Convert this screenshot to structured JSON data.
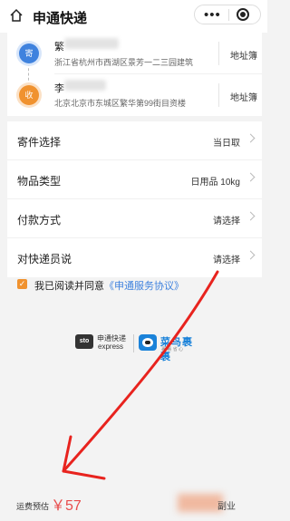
{
  "header": {
    "title": "申通快递"
  },
  "sender": {
    "badge": "寄",
    "name": "繁",
    "address": "浙江省杭州市西湖区景芳一二三园建筑",
    "address_book": "地址簿"
  },
  "receiver": {
    "badge": "收",
    "name": "李",
    "address": "北京北京市东城区繁华第99街目资楼",
    "address_book": "地址簿"
  },
  "options": [
    {
      "label": "寄件选择",
      "value": "当日取"
    },
    {
      "label": "物品类型",
      "value": "日用品 10kg"
    },
    {
      "label": "付款方式",
      "value": "请选择"
    },
    {
      "label": "对快递员说",
      "value": "请选择"
    }
  ],
  "agreement": {
    "prefix": "我已阅读并同意",
    "link": "《申通服务协议》"
  },
  "logos": {
    "sto_box": "sto",
    "sto_cn": "申通快递",
    "sto_en": "express",
    "cainiao_cn": "菜鸟裹裹",
    "cainiao_en": "裹 裹 省 心"
  },
  "footer": {
    "fee_label": "运费预估",
    "fee_value": "￥57",
    "watermark": "副业"
  },
  "colors": {
    "accent_blue": "#3f82de",
    "accent_orange": "#f0922f",
    "price_red": "#e84a4a",
    "arrow_red": "#e8231e"
  }
}
